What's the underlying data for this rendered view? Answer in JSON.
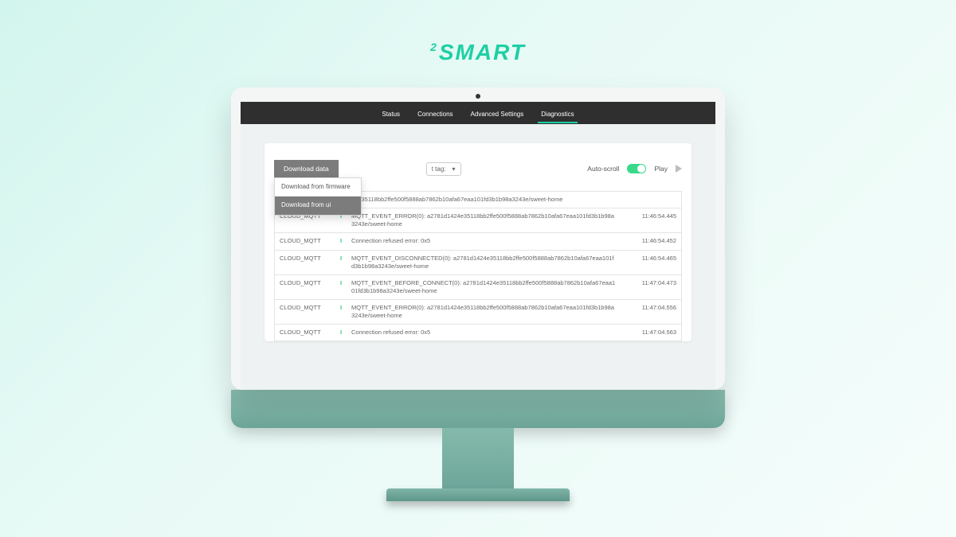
{
  "brand": {
    "sup": "2",
    "text": "SMART"
  },
  "nav": {
    "tabs": [
      {
        "label": "Status",
        "active": false
      },
      {
        "label": "Connections",
        "active": false
      },
      {
        "label": "Advanced Settings",
        "active": false
      },
      {
        "label": "Diagnostics",
        "active": true
      }
    ]
  },
  "toolbar": {
    "download_label": "Download data",
    "download_menu": [
      {
        "label": "Download from firmware",
        "hover": false
      },
      {
        "label": "Download from ui",
        "hover": true
      }
    ],
    "tag_label": "t tag:",
    "autoscroll_label": "Auto-scroll",
    "autoscroll_on": true,
    "play_label": "Play"
  },
  "log": {
    "rows": [
      {
        "src": "",
        "lvl": "",
        "msg": "24e35118bb2ffe500f5888ab7862b10afa67eaa101fd3b1b98a3243e/sweet-home",
        "ts": ""
      },
      {
        "src": "CLOUD_MQTT",
        "lvl": "I",
        "msg": "MQTT_EVENT_ERROR(0): a2781d1424e35118bb2ffe500f5888ab7862b10afa67eaa101fd3b1b98a3243e/sweet-home",
        "ts": "11:46:54.445"
      },
      {
        "src": "CLOUD_MQTT",
        "lvl": "I",
        "msg": "Connection refused error: 0x5",
        "ts": "11:46:54.452"
      },
      {
        "src": "CLOUD_MQTT",
        "lvl": "I",
        "msg": "MQTT_EVENT_DISCONNECTED(0): a2781d1424e35118bb2ffe500f5888ab7862b10afa67eaa101fd3b1b98a3243e/sweet-home",
        "ts": "11:46:54.465"
      },
      {
        "src": "CLOUD_MQTT",
        "lvl": "I",
        "msg": "MQTT_EVENT_BEFORE_CONNECT(0): a2781d1424e35118bb2ffe500f5888ab7862b10afa67eaa101fd3b1b98a3243e/sweet-home",
        "ts": "11:47:04.473"
      },
      {
        "src": "CLOUD_MQTT",
        "lvl": "I",
        "msg": "MQTT_EVENT_ERROR(0): a2781d1424e35118bb2ffe500f5888ab7862b10afa67eaa101fd3b1b98a3243e/sweet-home",
        "ts": "11:47:04.556"
      },
      {
        "src": "CLOUD_MQTT",
        "lvl": "I",
        "msg": "Connection refused error: 0x5",
        "ts": "11:47:04.563"
      }
    ]
  }
}
